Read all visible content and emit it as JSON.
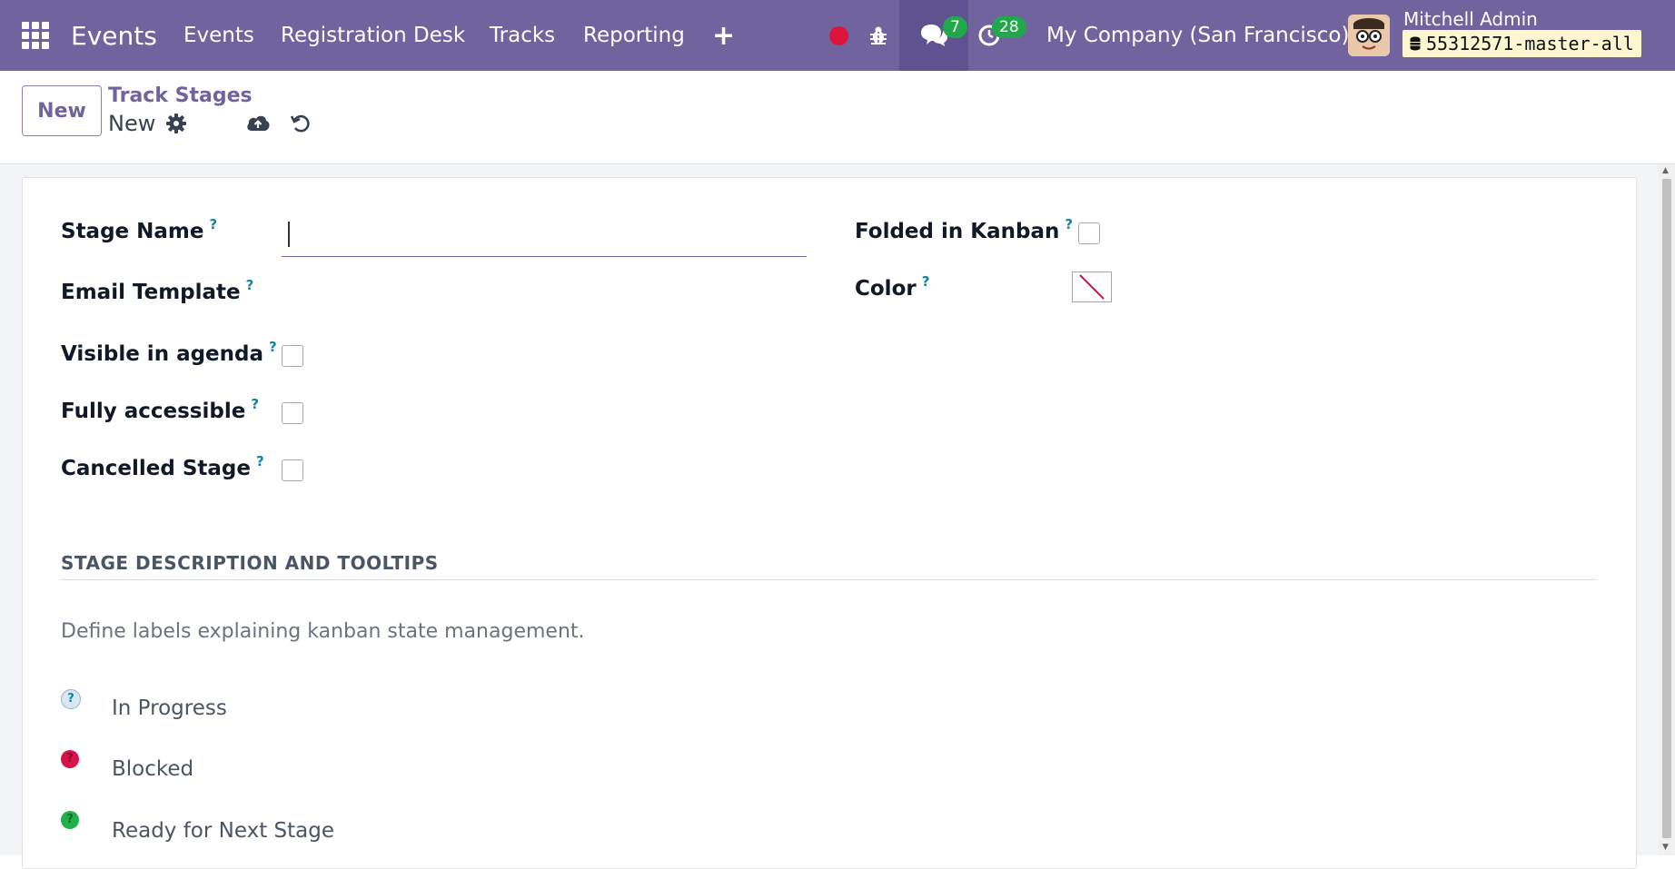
{
  "navbar": {
    "app_title": "Events",
    "menu": [
      "Events",
      "Registration Desk",
      "Tracks",
      "Reporting"
    ],
    "chat_count": "7",
    "activity_count": "28",
    "company": "My Company (San Francisco)",
    "user_name": "Mitchell Admin",
    "database": "55312571-master-all"
  },
  "control_panel": {
    "new_button": "New",
    "breadcrumb": "Track Stages",
    "record_name": "New"
  },
  "form": {
    "help_mark": "?",
    "stage_name_label": "Stage Name",
    "stage_name_value": "",
    "email_template_label": "Email Template",
    "visible_in_agenda_label": "Visible in agenda",
    "fully_accessible_label": "Fully accessible",
    "cancelled_stage_label": "Cancelled Stage",
    "folded_in_kanban_label": "Folded in Kanban",
    "color_label": "Color",
    "checkboxes": {
      "visible_in_agenda": false,
      "fully_accessible": false,
      "cancelled_stage": false,
      "folded_in_kanban": false
    }
  },
  "section": {
    "title": "STAGE DESCRIPTION AND TOOLTIPS",
    "description": "Define labels explaining kanban state management.",
    "states": [
      {
        "label": "In Progress",
        "color": "#dbe7ee",
        "mark": "?"
      },
      {
        "label": "Blocked",
        "color": "#d6144b",
        "mark": "?"
      },
      {
        "label": "Ready for Next Stage",
        "color": "#21b14b",
        "mark": "?"
      }
    ]
  },
  "colors": {
    "navbar": "#71639e",
    "accent": "#71639e",
    "help": "#0e83ac"
  }
}
